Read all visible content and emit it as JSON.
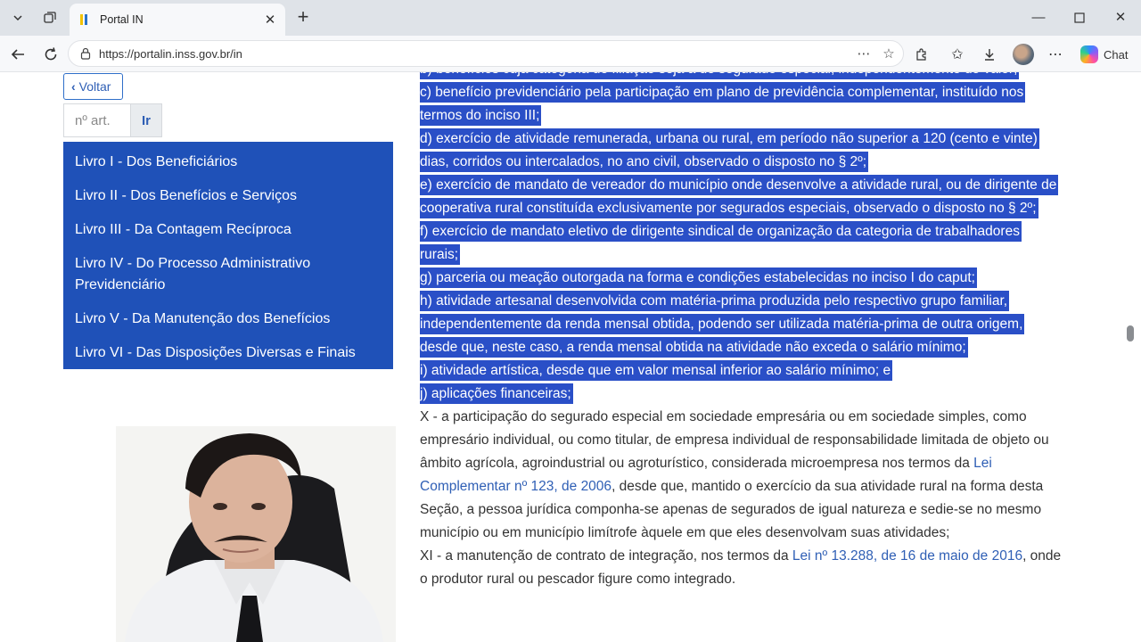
{
  "browser": {
    "tab_title": "Portal IN",
    "url": "https://portalin.inss.gov.br/in",
    "chat_label": "Chat"
  },
  "sidebar": {
    "back_label": "Voltar",
    "article_placeholder": "nº art.",
    "go_label": "Ir",
    "items": [
      {
        "label": "Livro I - Dos Beneficiários"
      },
      {
        "label": "Livro II - Dos Benefícios e Serviços"
      },
      {
        "label": "Livro III - Da Contagem Recíproca"
      },
      {
        "label": "Livro IV - Do Processo Administrativo Previdenciário"
      },
      {
        "label": "Livro V - Da Manutenção dos Benefícios"
      },
      {
        "label": "Livro VI - Das Disposições Diversas e Finais"
      }
    ]
  },
  "article": {
    "selected_items": [
      "b) benefícios cuja categoria de filiação seja a de segurado especial, independentemente do valor;",
      "c) benefício previdenciário pela participação em plano de previdência complementar, instituído nos termos do inciso III;",
      "d) exercício de atividade remunerada, urbana ou rural, em período não superior a 120 (cento e vinte) dias, corridos ou intercalados, no ano civil, observado o disposto no § 2º;",
      "e) exercício de mandato de vereador do município onde desenvolve a atividade rural, ou de dirigente de cooperativa rural constituída exclusivamente por segurados especiais, observado o disposto no § 2º;",
      "f) exercício de mandato eletivo de dirigente sindical de organização da categoria de trabalhadores rurais;",
      "g) parceria ou meação outorgada na forma e condições estabelecidas no inciso I do caput;",
      "h) atividade artesanal desenvolvida com matéria-prima produzida pelo respectivo grupo familiar, independentemente da renda mensal obtida, podendo ser utilizada matéria-prima de outra origem, desde que, neste caso, a renda mensal obtida na atividade não exceda o salário mínimo;",
      "i) atividade artística, desde que em valor mensal inferior ao salário mínimo; e",
      "j) aplicações financeiras;"
    ],
    "item_x_part1": "X - a participação do segurado especial em sociedade empresária ou em sociedade simples, como empresário individual, ou como titular, de empresa individual de responsabilidade limitada de objeto ou âmbito agrícola, agroindustrial ou agroturístico, considerada microempresa nos termos da ",
    "item_x_link": "Lei Complementar nº 123, de 2006",
    "item_x_part2": ", desde que, mantido o exercício da sua atividade rural na forma desta Seção, a pessoa jurídica componha-se apenas de segurados de igual natureza e sedie-se no mesmo município ou em município limítrofe àquele em que eles desenvolvam suas atividades;",
    "item_xi_part1": "XI - a manutenção de contrato de integração, nos termos da ",
    "item_xi_link": "Lei nº 13.288, de 16 de maio de 2016",
    "item_xi_part2": ", onde o produtor rural ou pescador figure como integrado."
  }
}
